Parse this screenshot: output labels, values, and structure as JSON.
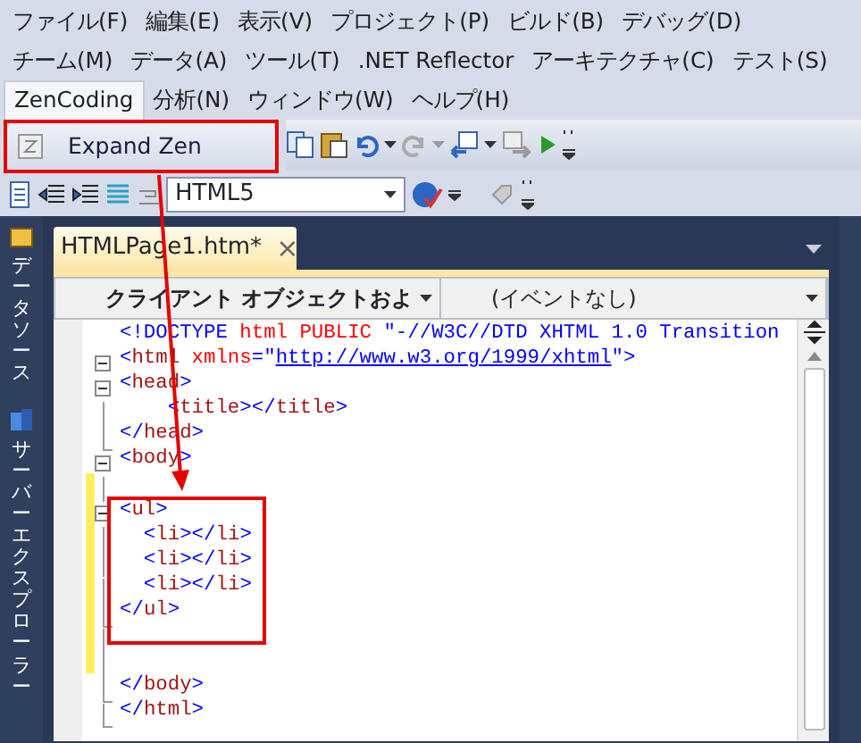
{
  "menu_rows": [
    [
      {
        "label": "ファイル(F)",
        "selected": false
      },
      {
        "label": "編集(E)",
        "selected": false
      },
      {
        "label": "表示(V)",
        "selected": false
      },
      {
        "label": "プロジェクト(P)",
        "selected": false
      },
      {
        "label": "ビルド(B)",
        "selected": false
      },
      {
        "label": "デバッグ(D)",
        "selected": false
      }
    ],
    [
      {
        "label": "チーム(M)",
        "selected": false
      },
      {
        "label": "データ(A)",
        "selected": false
      },
      {
        "label": "ツール(T)",
        "selected": false
      },
      {
        "label": ".NET Reflector",
        "selected": false
      },
      {
        "label": "アーキテクチャ(C)",
        "selected": false
      },
      {
        "label": "テスト(S)",
        "selected": false
      }
    ],
    [
      {
        "label": "ZenCoding",
        "selected": true
      },
      {
        "label": "分析(N)",
        "selected": false
      },
      {
        "label": "ウィンドウ(W)",
        "selected": false
      },
      {
        "label": "ヘルプ(H)",
        "selected": false
      }
    ]
  ],
  "toolbar": {
    "expand_button": "Expand Zen",
    "format_select": "HTML5"
  },
  "side_panels": [
    "データソース",
    "サーバーエクスプローラー"
  ],
  "document_tab": {
    "title": "HTMLPage1.htm*",
    "close": "×"
  },
  "editor": {
    "object_select": "クライアント オブジェクトおよ",
    "event_select": "(イベントなし)",
    "lines": [
      {
        "kind": "plain",
        "changed": false,
        "segments": [
          {
            "kind": "tag",
            "text": "<!DOCTYPE"
          },
          {
            "kind": "attr",
            "text": " html PUBLIC "
          },
          {
            "kind": "string",
            "text": "\"-//W3C//DTD XHTML 1.0 Transition"
          }
        ]
      },
      {
        "kind": "fold",
        "changed": false,
        "segments": [
          {
            "kind": "tag",
            "text": "<"
          },
          {
            "kind": "name",
            "text": "html"
          },
          {
            "kind": "attr",
            "text": " xmlns"
          },
          {
            "kind": "tag",
            "text": "=\""
          },
          {
            "kind": "link",
            "text": "http://www.w3.org/1999/xhtml"
          },
          {
            "kind": "tag",
            "text": "\">"
          }
        ]
      },
      {
        "kind": "fold",
        "changed": false,
        "segments": [
          {
            "kind": "tag",
            "text": "<"
          },
          {
            "kind": "name",
            "text": "head"
          },
          {
            "kind": "tag",
            "text": ">"
          }
        ]
      },
      {
        "kind": "inner",
        "changed": false,
        "segments": [
          {
            "kind": "tag",
            "text": "    <"
          },
          {
            "kind": "name",
            "text": "title"
          },
          {
            "kind": "tag",
            "text": "></"
          },
          {
            "kind": "name",
            "text": "title"
          },
          {
            "kind": "tag",
            "text": ">"
          }
        ]
      },
      {
        "kind": "close",
        "changed": false,
        "segments": [
          {
            "kind": "tag",
            "text": "</"
          },
          {
            "kind": "name",
            "text": "head"
          },
          {
            "kind": "tag",
            "text": ">"
          }
        ]
      },
      {
        "kind": "fold",
        "changed": false,
        "segments": [
          {
            "kind": "tag",
            "text": "<"
          },
          {
            "kind": "name",
            "text": "body"
          },
          {
            "kind": "tag",
            "text": ">"
          }
        ]
      },
      {
        "kind": "inner",
        "changed": true
      },
      {
        "kind": "fold",
        "changed": true,
        "segments": [
          {
            "kind": "tag",
            "text": "<"
          },
          {
            "kind": "name",
            "text": "ul"
          },
          {
            "kind": "tag",
            "text": ">"
          }
        ]
      },
      {
        "kind": "inner",
        "changed": true,
        "segments": [
          {
            "kind": "tag",
            "text": "  <"
          },
          {
            "kind": "name",
            "text": "li"
          },
          {
            "kind": "tag",
            "text": "></"
          },
          {
            "kind": "name",
            "text": "li"
          },
          {
            "kind": "tag",
            "text": ">"
          }
        ]
      },
      {
        "kind": "inner",
        "changed": true,
        "segments": [
          {
            "kind": "tag",
            "text": "  <"
          },
          {
            "kind": "name",
            "text": "li"
          },
          {
            "kind": "tag",
            "text": "></"
          },
          {
            "kind": "name",
            "text": "li"
          },
          {
            "kind": "tag",
            "text": ">"
          }
        ]
      },
      {
        "kind": "inner",
        "changed": true,
        "segments": [
          {
            "kind": "tag",
            "text": "  <"
          },
          {
            "kind": "name",
            "text": "li"
          },
          {
            "kind": "tag",
            "text": "></"
          },
          {
            "kind": "name",
            "text": "li"
          },
          {
            "kind": "tag",
            "text": ">"
          }
        ]
      },
      {
        "kind": "close",
        "changed": true,
        "segments": [
          {
            "kind": "tag",
            "text": "</"
          },
          {
            "kind": "name",
            "text": "ul"
          },
          {
            "kind": "tag",
            "text": ">"
          }
        ]
      },
      {
        "kind": "inner",
        "changed": true
      },
      {
        "kind": "inner",
        "changed": true
      },
      {
        "kind": "close",
        "changed": false,
        "segments": [
          {
            "kind": "tag",
            "text": "</"
          },
          {
            "kind": "name",
            "text": "body"
          },
          {
            "kind": "tag",
            "text": ">"
          }
        ]
      },
      {
        "kind": "close",
        "changed": false,
        "segments": [
          {
            "kind": "tag",
            "text": "</"
          },
          {
            "kind": "name",
            "text": "html"
          },
          {
            "kind": "tag",
            "text": ">"
          }
        ]
      }
    ]
  }
}
